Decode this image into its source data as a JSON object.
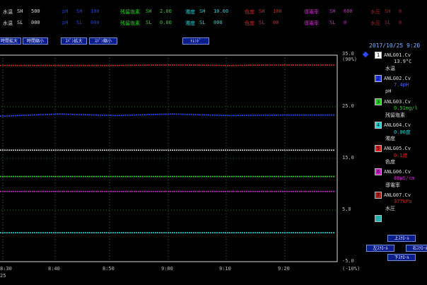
{
  "settings": {
    "row1": [
      {
        "label": "水温",
        "tag": "SH",
        "value": "500",
        "color": "#d8d8d8"
      },
      {
        "label": "pH",
        "tag": "SH",
        "value": "100",
        "color": "#1d3cff"
      },
      {
        "label": "残留塩素",
        "tag": "SH",
        "value": "2.00",
        "color": "#27d227"
      },
      {
        "label": "濁度",
        "tag": "SH",
        "value": "10.00",
        "color": "#27d2d2"
      },
      {
        "label": "色度",
        "tag": "SH",
        "value": "100",
        "color": "#d22727"
      },
      {
        "label": "導電率",
        "tag": "SH",
        "value": "600",
        "color": "#d227d2"
      },
      {
        "label": "水圧",
        "tag": "SH",
        "value": "0",
        "color": "#a82020"
      }
    ],
    "row2": [
      {
        "label": "水温",
        "tag": "SL",
        "value": "000",
        "color": "#d8d8d8"
      },
      {
        "label": "pH",
        "tag": "SL",
        "value": "000",
        "color": "#1d3cff"
      },
      {
        "label": "残留塩素",
        "tag": "SL",
        "value": "0.00",
        "color": "#27d227"
      },
      {
        "label": "濁度",
        "tag": "SL",
        "value": "000",
        "color": "#27d2d2"
      },
      {
        "label": "色度",
        "tag": "SL",
        "value": "00",
        "color": "#d22727"
      },
      {
        "label": "導電率",
        "tag": "SL",
        "value": "0",
        "color": "#d227d2"
      },
      {
        "label": "水圧",
        "tag": "SL",
        "value": "0",
        "color": "#a82020"
      }
    ]
  },
  "toolbar": {
    "time_expand": "時間拡大",
    "time_shrink": "時間縮小",
    "span_expand": "ｽﾊﾟﾝ拡大",
    "span_shrink": "ｽﾊﾟﾝ縮小",
    "trend_tab": "ﾄﾚﾝﾄﾞ"
  },
  "timestamp": "2017/10/25 9:20",
  "axis": {
    "top_value": "35.0",
    "top_unit": "(90%)",
    "bottom_unit": "(-10%)",
    "right_ticks": [
      "35.0",
      "25.0",
      "15.0",
      "5.0",
      "-5.0"
    ],
    "x_ticks": [
      "8:30",
      "8:40",
      "8:50",
      "9:00",
      "9:10",
      "9:20"
    ],
    "x_date": "25"
  },
  "legend": [
    {
      "num": "1",
      "tag": "ANLG01.Cv",
      "value": "13.9°C",
      "name": "水温",
      "swatch": "#ffffff",
      "valcolor": "#d8d8d8"
    },
    {
      "num": "2",
      "tag": "ANLG02.Cv",
      "value": "7.4pH",
      "name": "pH",
      "swatch": "#1d3cff",
      "valcolor": "#4a6bff"
    },
    {
      "num": "3",
      "tag": "ANLG03.Cv",
      "value": "0.51mg/l",
      "name": "残留塩素",
      "swatch": "#27d227",
      "valcolor": "#27d227"
    },
    {
      "num": "4",
      "tag": "ANLG04.Cv",
      "value": "0.00度",
      "name": "濁度",
      "swatch": "#27d2d2",
      "valcolor": "#27d2d2"
    },
    {
      "num": "5",
      "tag": "ANLG05.Cv",
      "value": "0.1度",
      "name": "色度",
      "swatch": "#e02424",
      "valcolor": "#e02424"
    },
    {
      "num": "6",
      "tag": "ANLG06.Cv",
      "value": "88μS/cm",
      "name": "導電率",
      "swatch": "#d227d2",
      "valcolor": "#d227d2"
    },
    {
      "num": "7",
      "tag": "ANLG07.Cv",
      "value": "377kPa",
      "name": "水圧",
      "swatch": "#a82020",
      "valcolor": "#d22727"
    },
    {
      "num": "",
      "tag": "",
      "value": "",
      "name": "",
      "swatch": "#27b0b0",
      "valcolor": "#27b0b0"
    }
  ],
  "scroll_buttons": {
    "up": "上ｽｸﾛｰﾙ",
    "left": "左ｽｸﾛｰﾙ",
    "right": "右ｽｸﾛｰﾙ",
    "down": "下ｽｸﾛｰﾙ"
  },
  "chart_data": {
    "type": "line",
    "x": [
      "8:30",
      "8:40",
      "8:50",
      "9:00",
      "9:10",
      "9:20"
    ],
    "ylim": [
      -5,
      35
    ],
    "series": [
      {
        "name": "水温",
        "color": "#c82828",
        "values": [
          33.0,
          33.0,
          33.0,
          33.1,
          33.0,
          33.1
        ]
      },
      {
        "name": "pH",
        "color": "#2a4cff",
        "values": [
          23.2,
          23.6,
          23.3,
          23.6,
          23.3,
          23.4
        ]
      },
      {
        "name": "残留塩素",
        "color": "#d8d8d8",
        "values": [
          16.6,
          16.6,
          16.6,
          16.6,
          16.6,
          16.6
        ]
      },
      {
        "name": "濁度",
        "color": "#27d227",
        "values": [
          11.5,
          11.5,
          11.5,
          11.5,
          11.5,
          11.5
        ]
      },
      {
        "name": "色度",
        "color": "#c827c8",
        "values": [
          8.6,
          8.6,
          8.6,
          8.6,
          8.6,
          8.6
        ]
      },
      {
        "name": "導電率",
        "color": "#27d2d2",
        "values": [
          0.6,
          0.6,
          0.6,
          0.6,
          0.6,
          0.6
        ]
      }
    ]
  }
}
